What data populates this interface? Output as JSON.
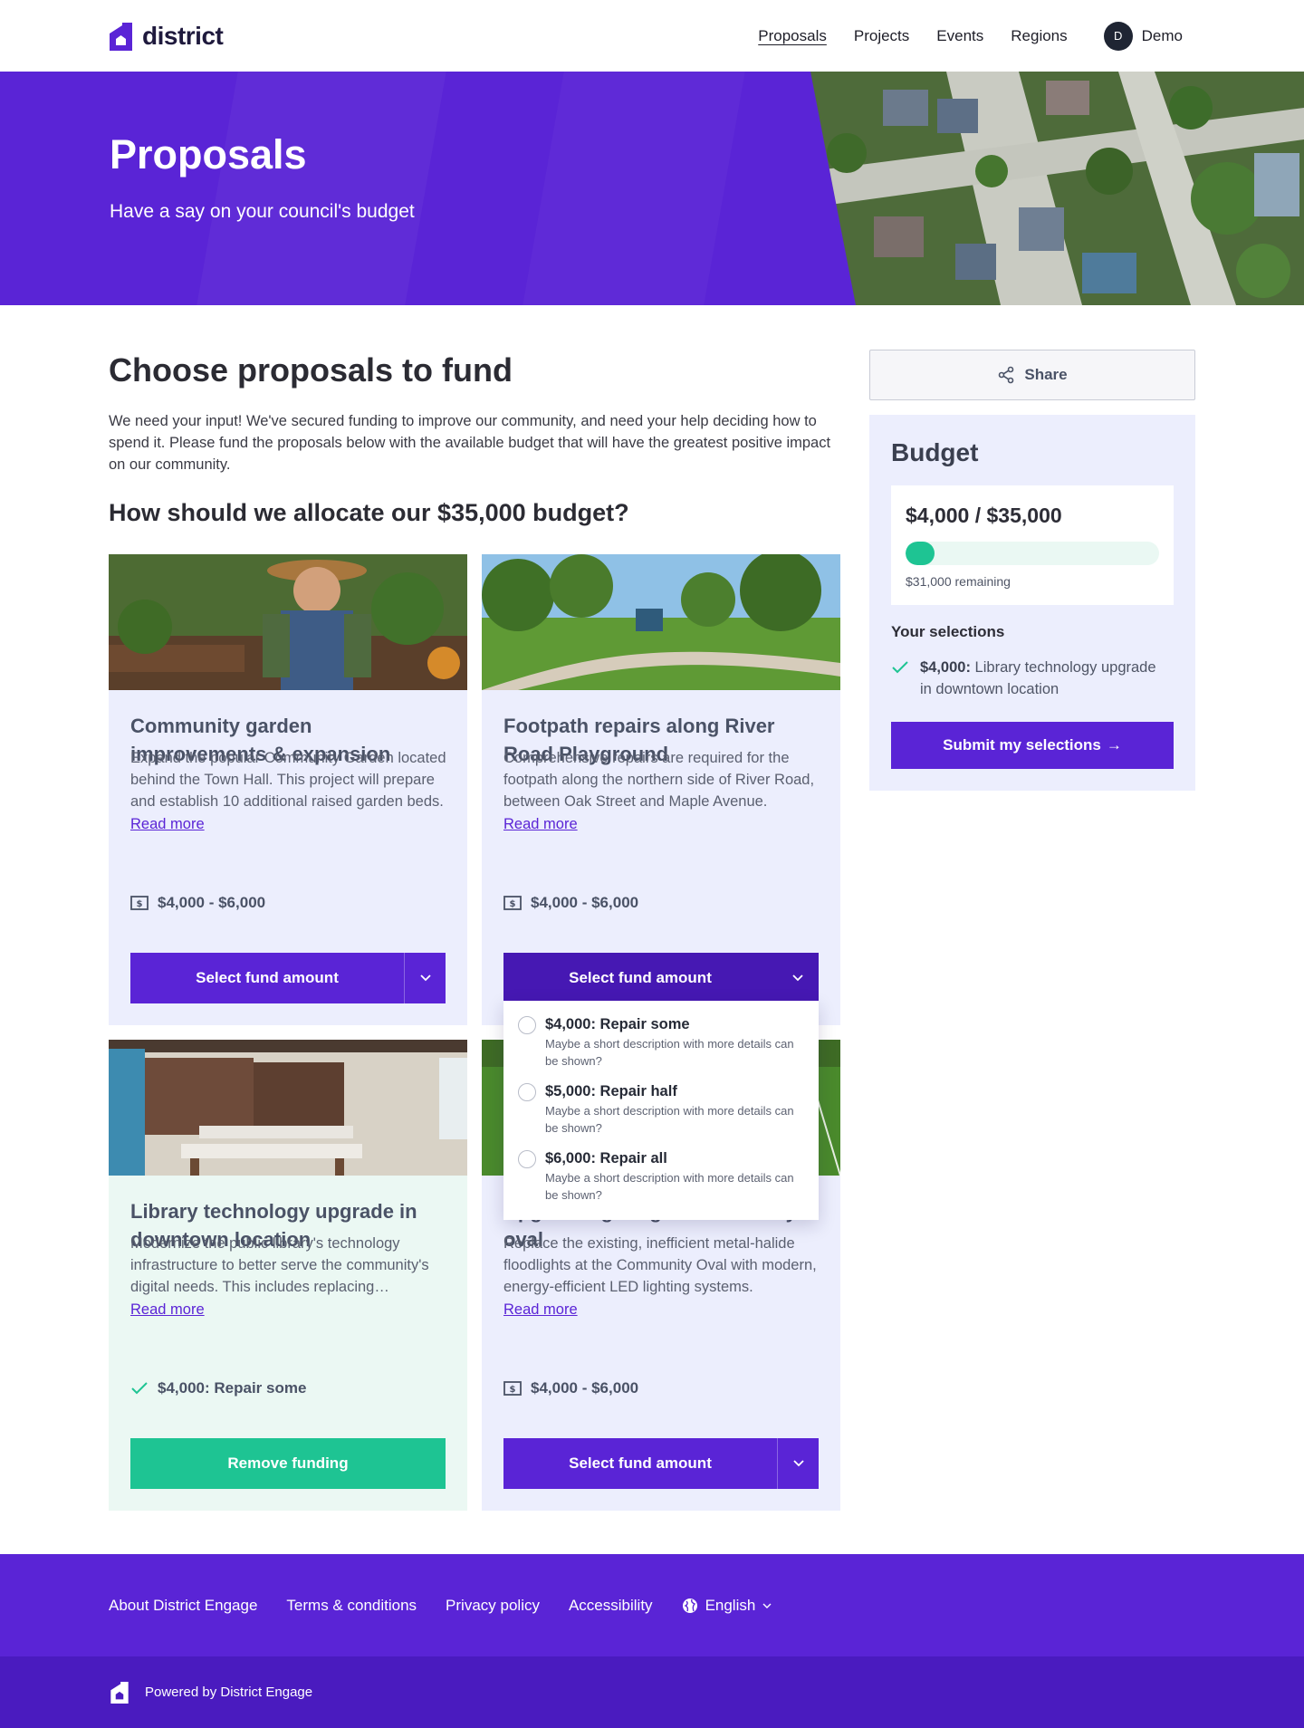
{
  "header": {
    "brand": "district",
    "nav": [
      "Proposals",
      "Projects",
      "Events",
      "Regions"
    ],
    "user": {
      "initial": "D",
      "name": "Demo"
    }
  },
  "hero": {
    "title": "Proposals",
    "subtitle": "Have a say on your council's budget"
  },
  "main": {
    "title": "Choose proposals to fund",
    "intro": "We need your input! We've secured funding to improve our community, and need your help deciding how to spend it.  Please fund the proposals below with the available budget that will have the greatest positive impact on our community.",
    "allocate_title": "How should we allocate our $35,000 budget?"
  },
  "cards": [
    {
      "title": "Community garden improvements & expansion",
      "description": "Expand the popular Community Garden located behind the Town Hall. This project will prepare and establish 10 additional raised garden beds.",
      "read_more": "Read more",
      "range": "$4,000 - $6,000",
      "button": "Select fund amount"
    },
    {
      "title": "Footpath repairs along River Road Playground",
      "description": "Comprehensive repairs are required for the footpath along the northern side of River Road, between Oak Street and Maple Avenue.",
      "read_more": "Read more",
      "range": "$4,000 - $6,000",
      "button": "Select fund amount"
    },
    {
      "title": "Library technology upgrade in downtown location",
      "description": "Modernize the public library's technology infrastructure to better serve the community's digital needs. This includes replacing computers.",
      "read_more": "Read more",
      "selected": "$4,000: Repair some",
      "button": "Remove funding"
    },
    {
      "title": "Upgrade lighting at community oval",
      "description": "Replace the existing, inefficient metal-halide floodlights at the Community Oval with modern, energy-efficient LED lighting systems.",
      "read_more": "Read more",
      "range": "$4,000 - $6,000",
      "button": "Select fund amount"
    }
  ],
  "dropdown": {
    "options": [
      {
        "label": "$4,000: Repair some",
        "description": "Maybe a short description with more details can be shown?"
      },
      {
        "label": "$5,000: Repair half",
        "description": "Maybe a short description with more details can be shown?"
      },
      {
        "label": "$6,000: Repair all",
        "description": "Maybe a short description with more details can be shown?"
      }
    ]
  },
  "sidebar": {
    "share": "Share",
    "budget_title": "Budget",
    "budget_amount": "$4,000 / $35,000",
    "progress_fraction": 0.114,
    "remaining": "$31,000 remaining",
    "selections_heading": "Your selections",
    "selection_amount": "$4,000:",
    "selection_text": " Library technology upgrade in downtown location",
    "submit": "Submit my selections",
    "submit_arrow": "→"
  },
  "footer": {
    "links": [
      "About District Engage",
      "Terms & conditions",
      "Privacy policy",
      "Accessibility"
    ],
    "language": "English",
    "powered": "Powered by District Engage"
  },
  "colors": {
    "brand": "#5a24d6",
    "card_bg": "#eceefd",
    "funded_bg": "#ebf8f3",
    "success": "#1ec493"
  },
  "icons": [
    "logo-house-icon",
    "share-icon",
    "check-icon",
    "money-icon",
    "chevron-down-icon",
    "globe-icon",
    "arrow-right-icon"
  ]
}
